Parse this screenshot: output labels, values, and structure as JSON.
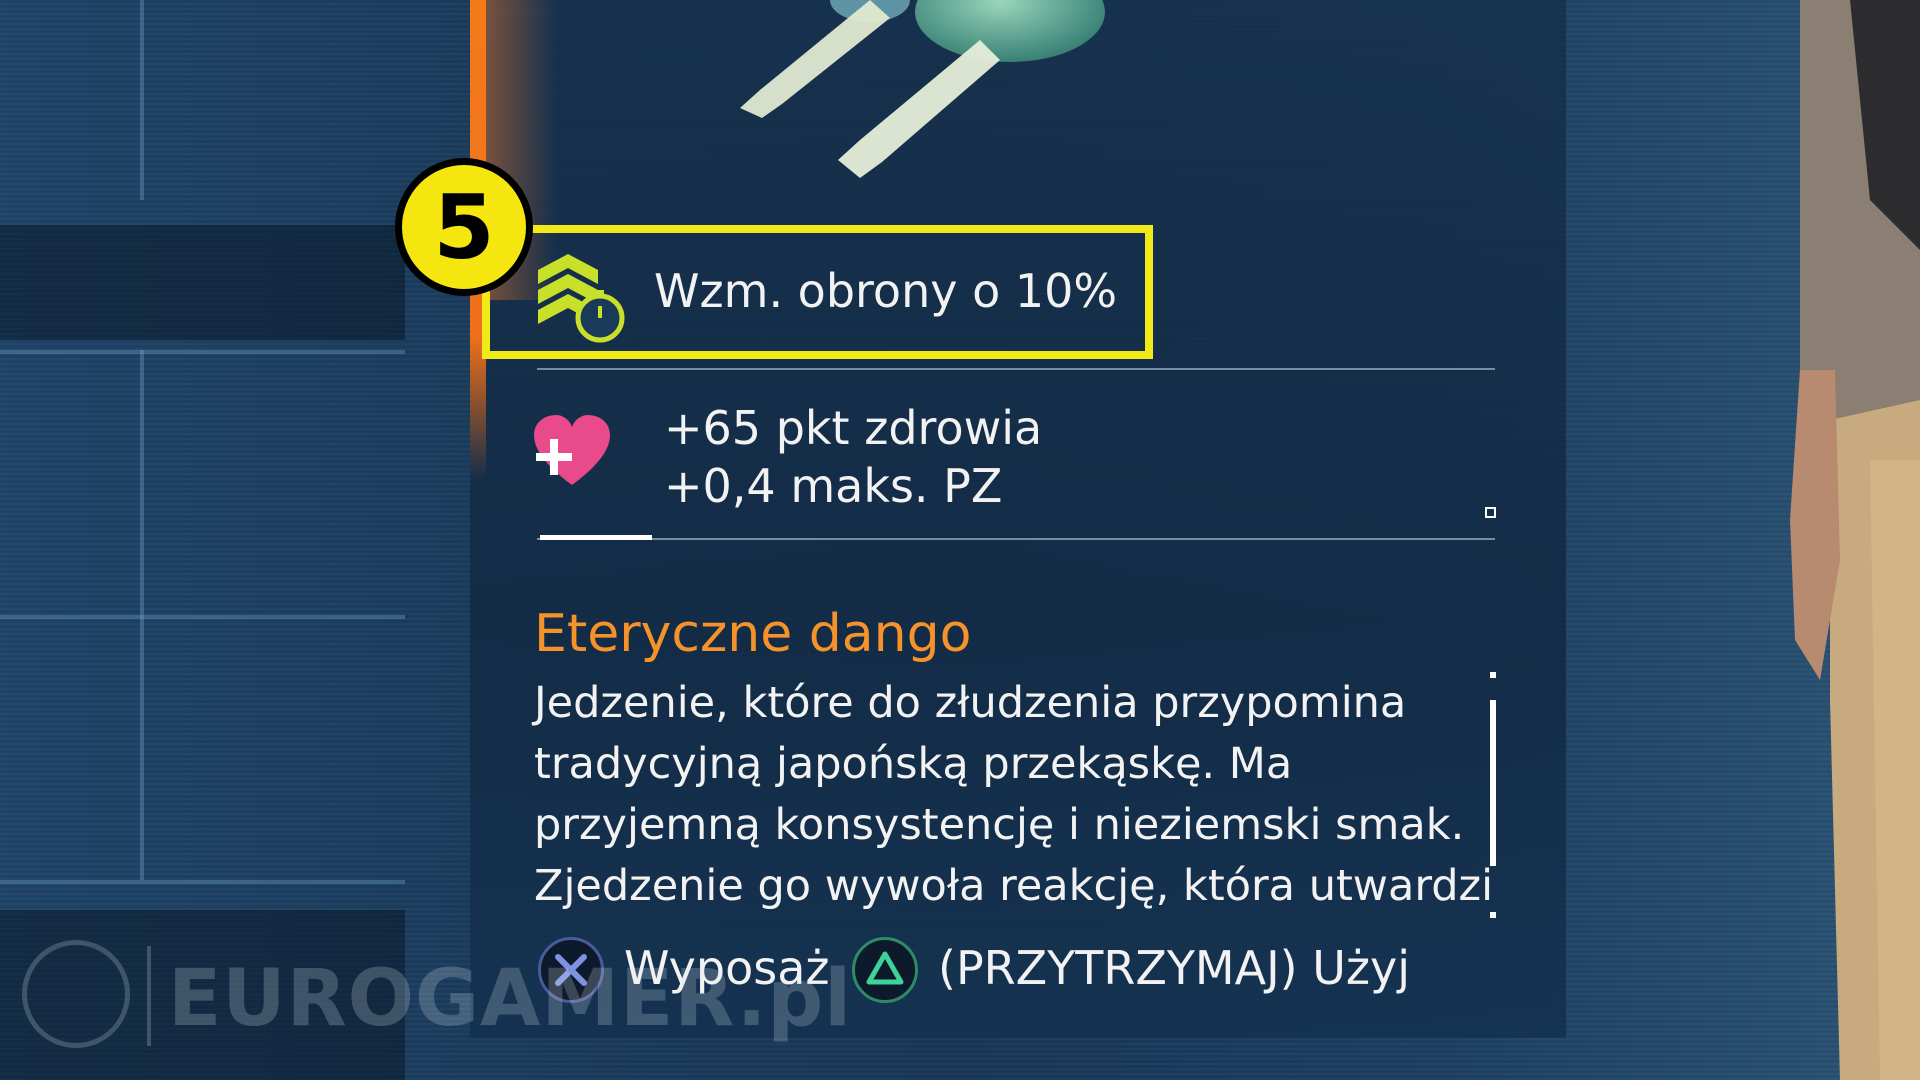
{
  "badge": {
    "number": "5"
  },
  "buff": {
    "label": "Wzm. obrony o 10%",
    "icon": "defense-up-timer-icon"
  },
  "health": {
    "icon": "heart-plus-icon",
    "line1": "+65 pkt zdrowia",
    "line2": "+0,4 maks. PZ"
  },
  "item": {
    "name": "Eteryczne dango",
    "description_lines": [
      "Jedzenie, które do złudzenia przypomina",
      "tradycyjną japońską przekąskę. Ma",
      "przyjemną konsystencję i nieziemski smak.",
      "Zjedzenie go wywoła reakcję, która utwardzi"
    ]
  },
  "actions": [
    {
      "button": "cross-button-icon",
      "label": "Wyposaż"
    },
    {
      "button": "triangle-button-icon",
      "label": "(PRZYTRZYMAJ) Użyj"
    }
  ],
  "watermark": {
    "text": "EUROGAMER.pl"
  },
  "colors": {
    "highlight": "#f2ea18",
    "item_name": "#f5922a",
    "accent_bar": "#f47a1a",
    "heart": "#e94a8a",
    "buff_icon": "#c8e02a"
  }
}
